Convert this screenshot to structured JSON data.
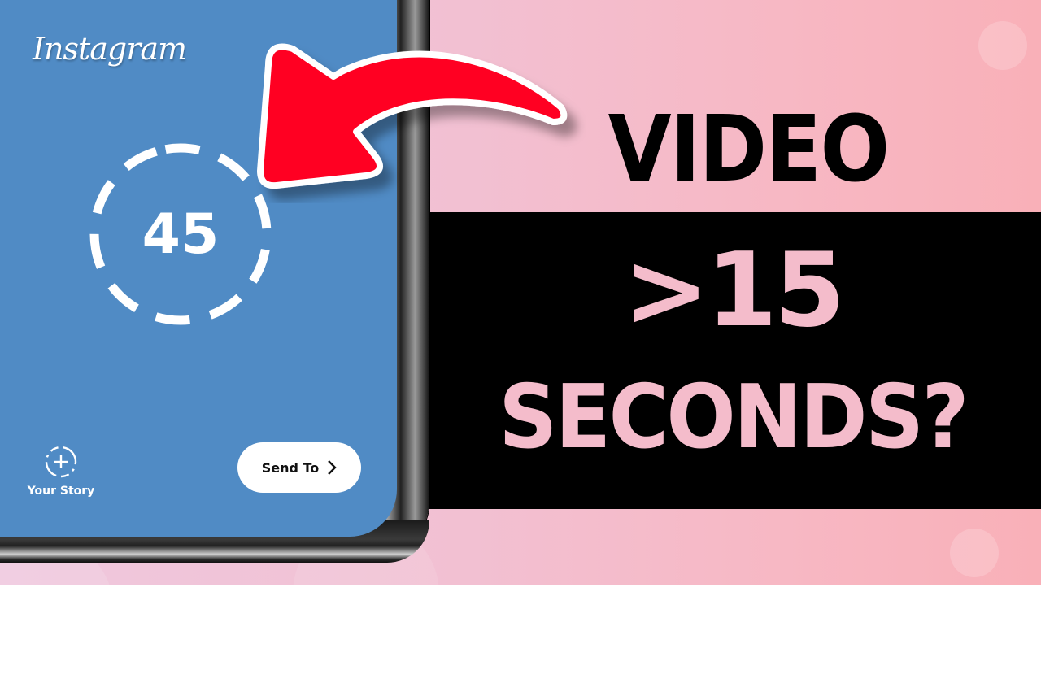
{
  "app": {
    "name": "Instagram"
  },
  "story_editor": {
    "timer_value": "45",
    "your_story_label": "Your Story",
    "send_to_label": "Send To",
    "send_to_icon": "chevron-right-icon"
  },
  "headline": {
    "line1": "VIDEO",
    "line2": ">15",
    "line3": "SECONDS?"
  },
  "colors": {
    "screen_blue": "#508bc5",
    "arrow_red": "#ff0022",
    "headline_pink": "#f4bccb",
    "band_black": "#000000",
    "bg_pink_left": "#efc8de",
    "bg_pink_right": "#f9b0b8"
  }
}
